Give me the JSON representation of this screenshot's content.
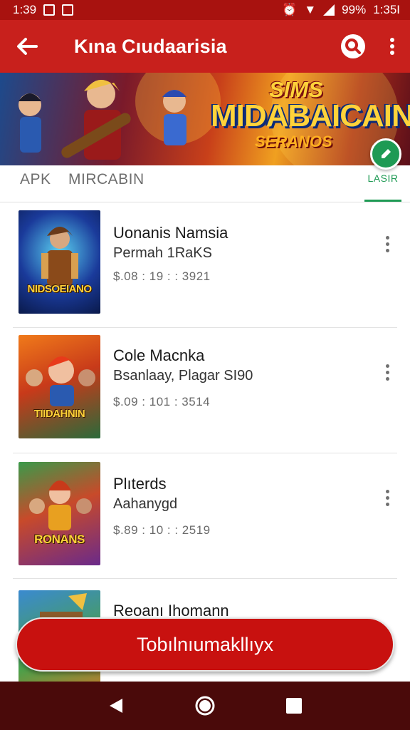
{
  "status_bar": {
    "time": "1:39",
    "battery": "99%",
    "clock_right": "1:35I"
  },
  "app_bar": {
    "back_icon": "arrow-left-icon",
    "title": "Kına Cıudaarisia",
    "search_icon": "search-icon",
    "more_icon": "more-vert-icon"
  },
  "banner": {
    "line1": "SIMS",
    "line2": "MIDABAICAIN",
    "line3": "SERANOS",
    "fab_icon": "edit-icon"
  },
  "tabs": {
    "apk": "APK",
    "library": "MIRCABIN",
    "latest": "LASIR"
  },
  "items": [
    {
      "title": "Uonanis Namsia",
      "subtitle": "Permah 1RaKS",
      "meta": "$.08 : 19 : : 3921",
      "thumb_label": "NIDSOEIANO"
    },
    {
      "title": "Cole Macnka",
      "subtitle": "Bsanlaay, Plagar SI90",
      "meta": "$.09 : 101 : 3514",
      "thumb_label": "TIIDAHNIN"
    },
    {
      "title": "Plıterds",
      "subtitle": "Aahanygd",
      "meta": "$.89 : 10 : : 2519",
      "thumb_label": "RONANS"
    },
    {
      "title": "Reoanı Ihomann",
      "subtitle": "",
      "meta": "",
      "thumb_label": ""
    }
  ],
  "cta": {
    "label": "Tobılnıumakllıyx"
  },
  "colors": {
    "app_bar": "#c8201c",
    "status_bar": "#a8120f",
    "cta": "#c8110f",
    "accent_green": "#1e9a54"
  }
}
